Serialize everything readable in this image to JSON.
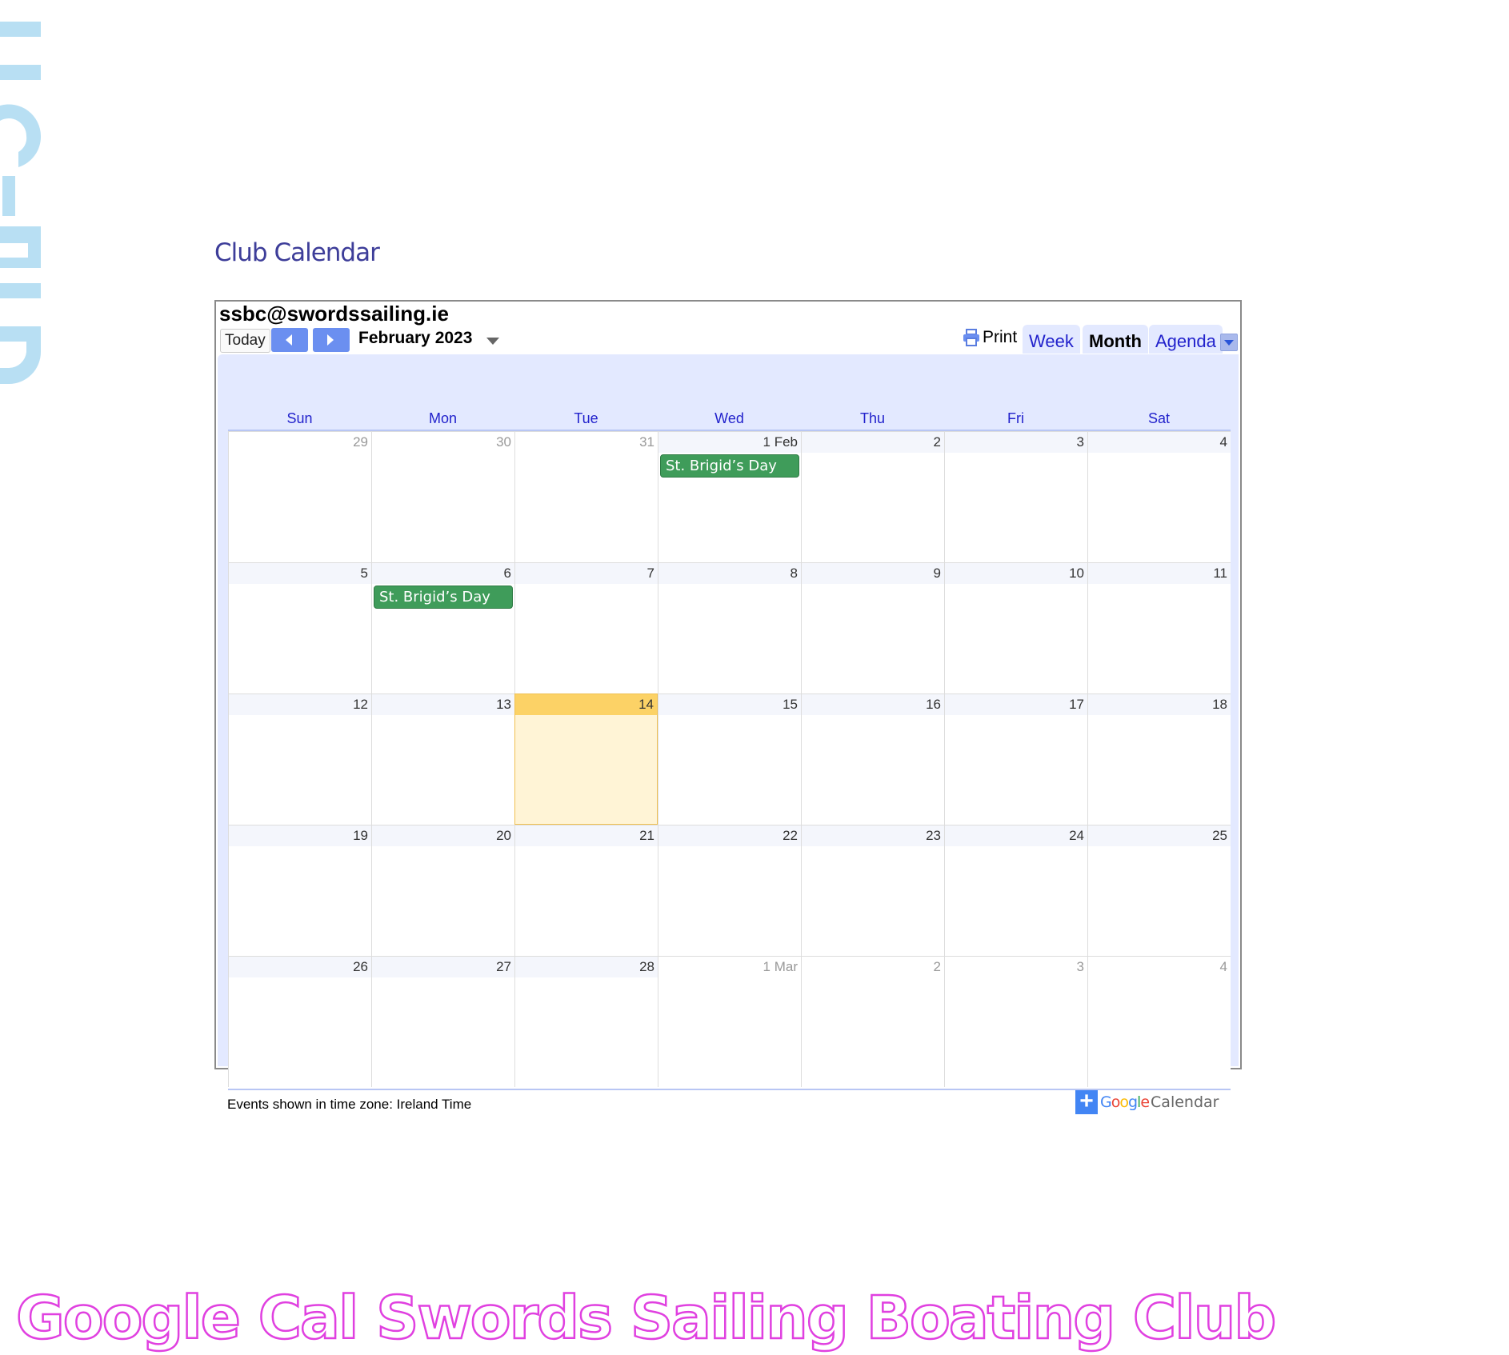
{
  "page": {
    "title": "Club Calendar",
    "caption": "Google Cal Swords Sailing Boating Club"
  },
  "calendar": {
    "account": "ssbc@swordssailing.ie",
    "today_label": "Today",
    "month_label": "February 2023",
    "print_label": "Print",
    "tabs": [
      {
        "label": "Week"
      },
      {
        "label": "Month",
        "active": true
      },
      {
        "label": "Agenda"
      }
    ],
    "weekdays": [
      "Sun",
      "Mon",
      "Tue",
      "Wed",
      "Thu",
      "Fri",
      "Sat"
    ],
    "weeks": [
      [
        {
          "d": "29",
          "off": true
        },
        {
          "d": "30",
          "off": true
        },
        {
          "d": "31",
          "off": true
        },
        {
          "d": "1 Feb",
          "event": "St. Brigid’s Day"
        },
        {
          "d": "2"
        },
        {
          "d": "3"
        },
        {
          "d": "4"
        }
      ],
      [
        {
          "d": "5"
        },
        {
          "d": "6",
          "event": "St. Brigid’s Day"
        },
        {
          "d": "7"
        },
        {
          "d": "8"
        },
        {
          "d": "9"
        },
        {
          "d": "10"
        },
        {
          "d": "11"
        }
      ],
      [
        {
          "d": "12"
        },
        {
          "d": "13"
        },
        {
          "d": "14",
          "today": true
        },
        {
          "d": "15"
        },
        {
          "d": "16"
        },
        {
          "d": "17"
        },
        {
          "d": "18"
        }
      ],
      [
        {
          "d": "19"
        },
        {
          "d": "20"
        },
        {
          "d": "21"
        },
        {
          "d": "22"
        },
        {
          "d": "23"
        },
        {
          "d": "24"
        },
        {
          "d": "25"
        }
      ],
      [
        {
          "d": "26"
        },
        {
          "d": "27"
        },
        {
          "d": "28"
        },
        {
          "d": "1 Mar",
          "off": true
        },
        {
          "d": "2",
          "off": true
        },
        {
          "d": "3",
          "off": true
        },
        {
          "d": "4",
          "off": true
        }
      ]
    ],
    "timezone_note": "Events shown in time zone: Ireland Time",
    "badge": {
      "google": "Google",
      "calendar": "Calendar"
    }
  },
  "colors": {
    "event": "#3f9c5a",
    "today": "#fcd266",
    "header_bg": "#e3e9ff",
    "link": "#2222cc",
    "caption_outline": "#e040e0",
    "decor": "#b8dff3"
  }
}
